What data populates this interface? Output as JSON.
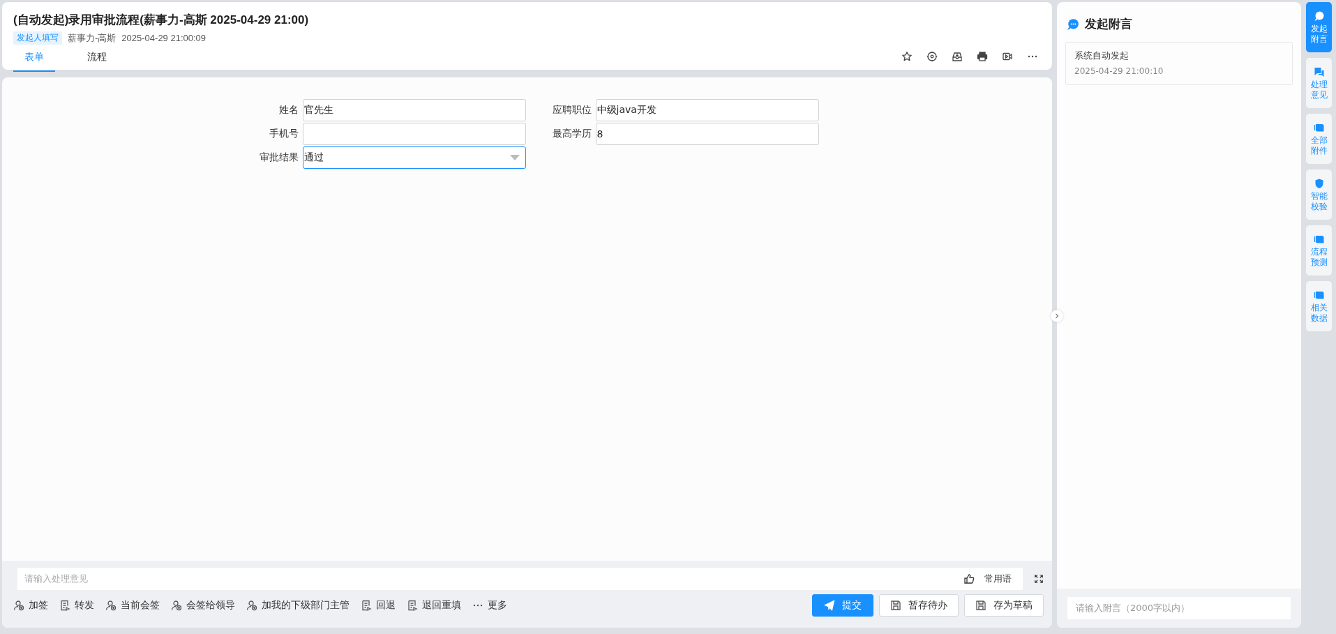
{
  "header": {
    "title": "(自动发起)录用审批流程(薪事力-高斯 2025-04-29 21:00)",
    "tag": "发起人填写",
    "initiator": "薪事力-高斯",
    "time": "2025-04-29 21:00:09"
  },
  "tabs": [
    {
      "label": "表单",
      "selected": true
    },
    {
      "label": "流程",
      "selected": false
    }
  ],
  "toolbar": [
    {
      "kind": "star"
    },
    {
      "kind": "target"
    },
    {
      "kind": "inbox"
    },
    {
      "kind": "print"
    },
    {
      "kind": "video"
    },
    {
      "kind": "more"
    }
  ],
  "form": {
    "fields": [
      {
        "label": "姓名",
        "value": "官先生",
        "kind": "text",
        "focused": false
      },
      {
        "label": "应聘职位",
        "value": "中级java开发",
        "kind": "text",
        "focused": false
      },
      {
        "label": "手机号",
        "kind": "text",
        "focused": false
      },
      {
        "label": "最高学历",
        "value": "8",
        "kind": "text",
        "focused": false
      },
      {
        "label": "审批结果",
        "value": "通过",
        "kind": "select",
        "focused": true
      }
    ]
  },
  "opinion": {
    "placeholder": "请输入处理意见",
    "phrases": "常用语"
  },
  "actions": [
    {
      "label": "加签",
      "kind": "person"
    },
    {
      "label": "转发",
      "kind": "doc"
    },
    {
      "label": "当前会签",
      "kind": "person"
    },
    {
      "label": "会签给领导",
      "kind": "person"
    },
    {
      "label": "加我的下级部门主管",
      "kind": "person"
    },
    {
      "label": "回退",
      "kind": "doc"
    },
    {
      "label": "退回重填",
      "kind": "doc"
    },
    {
      "label": "更多",
      "kind": "more"
    }
  ],
  "buttons": [
    {
      "label": "提交",
      "kind": "primary"
    },
    {
      "label": "暂存待办",
      "kind": "save"
    },
    {
      "label": "存为草稿",
      "kind": "save"
    }
  ],
  "notes": {
    "title": "发起附言",
    "entries": [
      {
        "text": "系统自动发起",
        "time": "2025-04-29 21:00:10"
      }
    ],
    "placeholder": "请输入附言（2000字以内）"
  },
  "rail": [
    {
      "label": "发起附言",
      "selected": true
    },
    {
      "label": "处理意见",
      "selected": false
    },
    {
      "label": "全部附件",
      "selected": false
    },
    {
      "label": "智能校验",
      "selected": false
    },
    {
      "label": "流程预测",
      "selected": false
    },
    {
      "label": "相关数据",
      "selected": false
    }
  ]
}
